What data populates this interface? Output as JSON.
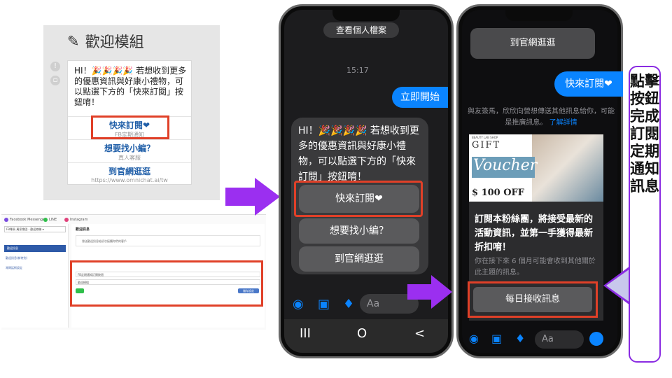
{
  "welcome_module": {
    "title": "歡迎模組",
    "message": "HI！🎉🎉🎉🎉 若想收到更多的優惠資訊與好康小禮物，可以點選下方的「快來訂閱」按鈕唷！",
    "buttons": [
      {
        "label": "快來訂閱❤",
        "sub": "FB定期通知"
      },
      {
        "label": "想要找小編？",
        "sub": "真人客服"
      },
      {
        "label": "到官網逛逛",
        "sub": "https://www.omnichat.ai/tw"
      }
    ]
  },
  "admin": {
    "tabs": [
      "Facebook Messenger",
      "LINE",
      "Instagram"
    ],
    "page_select": "FB專頁 萬家樂園 - 歡迎物聯 ▾",
    "nav_active": "歡迎訊息",
    "nav_items": [
      "歡迎訊息(新特別)",
      "常問話術設定"
    ],
    "panel_title": "歡迎訊息",
    "panel_hint": "發送歡迎訊息給初次接觸你們的客戶",
    "fields": [
      "FB定期通知訂閱按鈕",
      "歡迎模組"
    ],
    "save_label": "儲存設定"
  },
  "phone1": {
    "top_button": "查看個人檔案",
    "time": "15:17",
    "sent": "立即開始",
    "message": "HI！🎉🎉🎉🎉 若想收到更多的優惠資訊與好康小禮物，可以點選下方的「快來訂閱」按鈕唷！",
    "buttons": [
      "快來訂閱❤",
      "想要找小編？",
      "到官網逛逛"
    ],
    "input_placeholder": "Aa",
    "nav": [
      "III",
      "O",
      "<"
    ]
  },
  "phone2": {
    "top_button": "到官網逛逛",
    "sent": "快來訂閱❤",
    "notice": "與友簽馬，欣欣向營想傳送其他訊息給你，可能是推廣訊息。",
    "notice_link": "了解詳情",
    "voucher_small": "BEAUTY LAB SHOP",
    "voucher_gift": "GIFT",
    "voucher_script": "Voucher",
    "voucher_price": "$ 100 OFF",
    "offer_text": "訂閱本粉絲團，將接受最新的活動資訊，並第一手獲得最新折扣唷！",
    "offer_sub": "你在接下來 6 個月可能會收到其他關於此主題的訊息。",
    "daily_button": "每日接收訊息",
    "input_placeholder": "Aa"
  },
  "callout": {
    "text": "點擊按鈕完成訂閱定期通知訊息"
  },
  "colors": {
    "accent_red": "#e04028",
    "arrow_purple": "#9b2ff0",
    "messenger_blue": "#0a84ff",
    "link_blue": "#1f5ea8"
  }
}
